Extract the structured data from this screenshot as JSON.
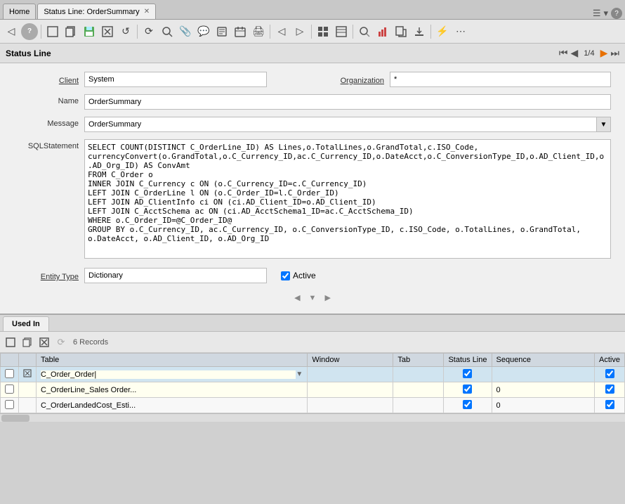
{
  "tabs": {
    "home": {
      "label": "Home",
      "active": false
    },
    "active": {
      "label": "Status Line: OrderSummary",
      "active": true,
      "closable": true
    }
  },
  "tab_controls": {
    "menu": "☰",
    "expand": "▾",
    "help": "?"
  },
  "toolbar": {
    "buttons": [
      {
        "name": "back",
        "icon": "◁",
        "title": "Back"
      },
      {
        "name": "help",
        "icon": "?",
        "title": "Help"
      },
      {
        "name": "sep1",
        "type": "sep"
      },
      {
        "name": "new",
        "icon": "□",
        "title": "New"
      },
      {
        "name": "copy",
        "icon": "⧉",
        "title": "Copy"
      },
      {
        "name": "save",
        "icon": "💾",
        "title": "Save"
      },
      {
        "name": "delete",
        "icon": "⊟",
        "title": "Delete"
      },
      {
        "name": "undo",
        "icon": "↺",
        "title": "Undo"
      },
      {
        "name": "sep2",
        "type": "sep"
      },
      {
        "name": "refresh",
        "icon": "⟳",
        "title": "Refresh"
      },
      {
        "name": "zoom",
        "icon": "🔍",
        "title": "Zoom"
      },
      {
        "name": "attach",
        "icon": "📎",
        "title": "Attach"
      },
      {
        "name": "chat",
        "icon": "💬",
        "title": "Chat"
      },
      {
        "name": "history",
        "icon": "📋",
        "title": "History"
      },
      {
        "name": "calendar",
        "icon": "📅",
        "title": "Calendar"
      },
      {
        "name": "print",
        "icon": "🖨",
        "title": "Print"
      },
      {
        "name": "sep3",
        "type": "sep"
      },
      {
        "name": "prev",
        "icon": "◁",
        "title": "Previous"
      },
      {
        "name": "next",
        "icon": "▶",
        "title": "Next"
      },
      {
        "name": "sep4",
        "type": "sep"
      },
      {
        "name": "grid",
        "icon": "▦",
        "title": "Grid"
      },
      {
        "name": "form",
        "icon": "▤",
        "title": "Form"
      },
      {
        "name": "sep5",
        "type": "sep"
      },
      {
        "name": "find",
        "icon": "🔍",
        "title": "Find"
      },
      {
        "name": "report",
        "icon": "📊",
        "title": "Report"
      },
      {
        "name": "export",
        "icon": "📤",
        "title": "Export"
      },
      {
        "name": "import",
        "icon": "📥",
        "title": "Import"
      },
      {
        "name": "sep6",
        "type": "sep"
      },
      {
        "name": "workflow",
        "icon": "⚡",
        "title": "Workflow"
      },
      {
        "name": "more",
        "icon": "⋯",
        "title": "More"
      }
    ]
  },
  "nav": {
    "title": "Status Line",
    "page": "1/4"
  },
  "form": {
    "client_label": "Client",
    "client_value": "System",
    "org_label": "Organization",
    "org_value": "*",
    "name_label": "Name",
    "name_value": "OrderSummary",
    "message_label": "Message",
    "message_value": "OrderSummary",
    "sql_label": "SQLStatement",
    "sql_value": "SELECT COUNT(DISTINCT C_OrderLine_ID) AS Lines,o.TotalLines,o.GrandTotal,c.ISO_Code,\ncurrencyConvert(o.GrandTotal,o.C_Currency_ID,ac.C_Currency_ID,o.DateAcct,o.C_ConversionType_ID,o.AD_Client_ID,o.AD_Org_ID) AS ConvAmt\nFROM C_Order o\nINNER JOIN C_Currency c ON (o.C_Currency_ID=c.C_Currency_ID)\nLEFT JOIN C_OrderLine l ON (o.C_Order_ID=l.C_Order_ID)\nLEFT JOIN AD_ClientInfo ci ON (ci.AD_Client_ID=o.AD_Client_ID)\nLEFT JOIN C_AcctSchema ac ON (ci.AD_AcctSchema1_ID=ac.C_AcctSchema_ID)\nWHERE o.C_Order_ID=@C_Order_ID@\nGROUP BY o.C_Currency_ID, ac.C_Currency_ID, o.C_ConversionType_ID, c.ISO_Code, o.TotalLines, o.GrandTotal,\no.DateAcct, o.AD_Client_ID, o.AD_Org_ID",
    "entity_type_label": "Entity Type",
    "entity_type_value": "Dictionary",
    "active_label": "Active",
    "active_checked": true,
    "sep_arrows": [
      "◀",
      "▼",
      "▶"
    ]
  },
  "bottom": {
    "tab_label": "Used In",
    "toolbar_buttons": [
      {
        "name": "new-row",
        "icon": "□"
      },
      {
        "name": "copy-row",
        "icon": "⧉"
      },
      {
        "name": "delete-row",
        "icon": "⊟"
      },
      {
        "name": "refresh-row",
        "icon": "⟳"
      }
    ],
    "records_count": "6 Records",
    "columns": [
      "",
      "",
      "Table",
      "Window",
      "Tab",
      "Status Line",
      "Sequence",
      "Active"
    ],
    "rows": [
      {
        "col1": false,
        "col2": true,
        "table": "C_Order_Order|",
        "table_editable": true,
        "window": "",
        "tab": "",
        "status_line": true,
        "sequence": "",
        "active": true,
        "row_class": "selected"
      },
      {
        "col1": false,
        "col2": false,
        "table": "C_OrderLine_Sales Order...",
        "window": "",
        "tab": "",
        "status_line": true,
        "sequence": "0",
        "active": true,
        "row_class": "odd"
      },
      {
        "col1": false,
        "col2": false,
        "table": "C_OrderLandedCost_Esti...",
        "window": "",
        "tab": "",
        "status_line": true,
        "sequence": "0",
        "active": true,
        "row_class": "even"
      }
    ]
  }
}
